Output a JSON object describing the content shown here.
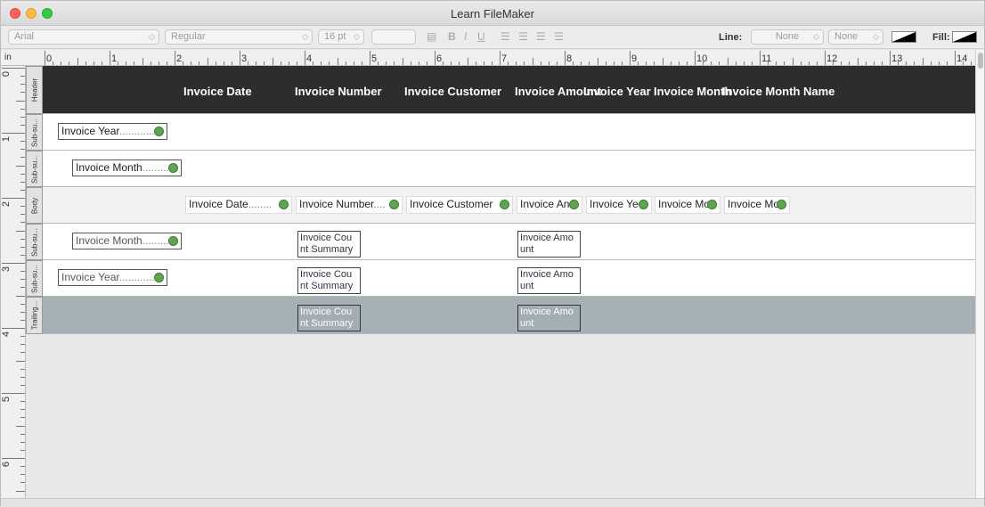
{
  "window": {
    "title": "Learn FileMaker"
  },
  "toolbar": {
    "font": "Arial",
    "style": "Regular",
    "size": "16 pt",
    "line_label": "Line:",
    "line_value1": "None",
    "line_value2": "None",
    "fill_label": "Fill:"
  },
  "ruler": {
    "unit": "in",
    "top_numbers": [
      "0",
      "1",
      "2",
      "3",
      "4",
      "5",
      "6",
      "7",
      "8",
      "9",
      "10",
      "11",
      "12",
      "13",
      "14"
    ],
    "left_numbers": [
      "0",
      "1",
      "2",
      "3",
      "4",
      "5",
      "6"
    ]
  },
  "parts": [
    {
      "label": "Header"
    },
    {
      "label": "Sub-su..."
    },
    {
      "label": "Sub-su..."
    },
    {
      "label": "Body"
    },
    {
      "label": "Sub-su..."
    },
    {
      "label": "Sub-su..."
    },
    {
      "label": "Trailing..."
    }
  ],
  "header_labels": [
    "Invoice Date",
    "Invoice Number",
    "Invoice Customer",
    "Invoice Amount",
    "Invoice Year",
    "Invoice Month",
    "Invoice Month Name"
  ],
  "subsummary_fields": {
    "year_top": "Invoice Year",
    "month_top": "Invoice Month",
    "month_bottom": "Invoice Month",
    "year_bottom": "Invoice Year"
  },
  "body_fields": [
    "Invoice Date",
    "Invoice Number",
    "Invoice Customer",
    "Invoice An",
    "Invoice Ye",
    "Invoice Mo",
    "Invoice Mo"
  ],
  "summary_fields": {
    "count": "Invoice Cou",
    "count2": "nt Summary",
    "amount": "Invoice Amo",
    "amount2": "unt Summary"
  }
}
